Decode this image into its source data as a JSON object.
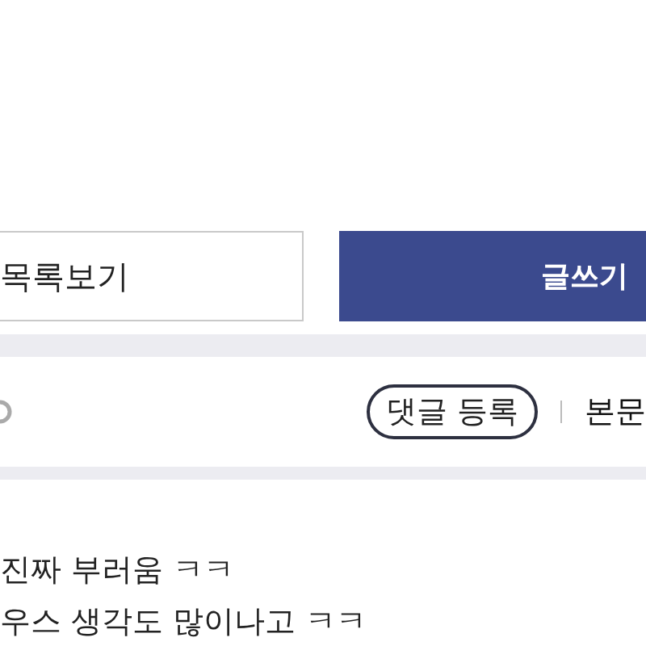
{
  "actions": {
    "list_button": "목록보기",
    "write_button": "글쓰기"
  },
  "comment_bar": {
    "register_button": "댓글 등록",
    "body_link": "본문"
  },
  "comments": [
    "진짜 부러움 ㅋㅋ",
    "우스 생각도 많이나고 ㅋㅋ"
  ]
}
